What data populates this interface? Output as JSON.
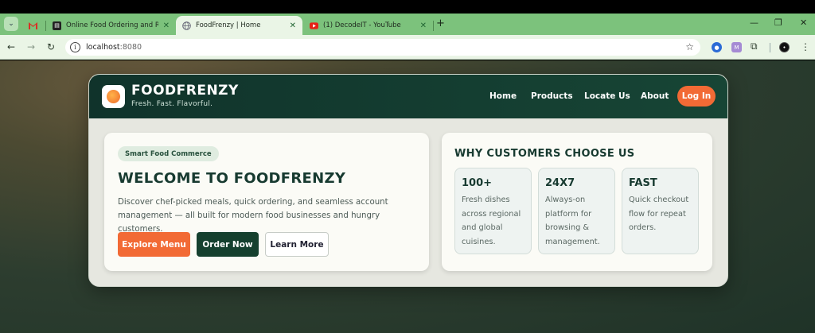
{
  "browser": {
    "tabs": [
      {
        "title": "",
        "favicon": "gmail-icon",
        "active": false
      },
      {
        "title": "Online Food Ordering and Rest",
        "favicon": "tab-favicon",
        "active": false
      },
      {
        "title": "FoodFrenzy | Home",
        "favicon": "globe-icon",
        "active": true
      },
      {
        "title": "(1) DecodeIT - YouTube",
        "favicon": "youtube-icon",
        "active": false
      }
    ],
    "url_host": "localhost",
    "url_port": ":8080"
  },
  "site": {
    "brand": "FOODFRENZY",
    "tagline": "Fresh. Fast. Flavorful.",
    "nav": [
      "Home",
      "Products",
      "Locate Us",
      "About"
    ],
    "login_label": "Log In",
    "accent_color": "#f26a35",
    "primary_color": "#15402f"
  },
  "hero": {
    "badge": "Smart Food Commerce",
    "title": "WELCOME TO FOODFRENZY",
    "description": "Discover chef-picked meals, quick ordering, and seamless account management — all built for modern food businesses and hungry customers.",
    "buttons": [
      "Explore Menu",
      "Order Now",
      "Learn More"
    ]
  },
  "why": {
    "title": "WHY CUSTOMERS CHOOSE US",
    "features": [
      {
        "big": "100+",
        "text": "Fresh dishes across regional and global cuisines."
      },
      {
        "big": "24X7",
        "text": "Always-on platform for browsing & management."
      },
      {
        "big": "FAST",
        "text": "Quick checkout flow for repeat orders."
      }
    ]
  }
}
